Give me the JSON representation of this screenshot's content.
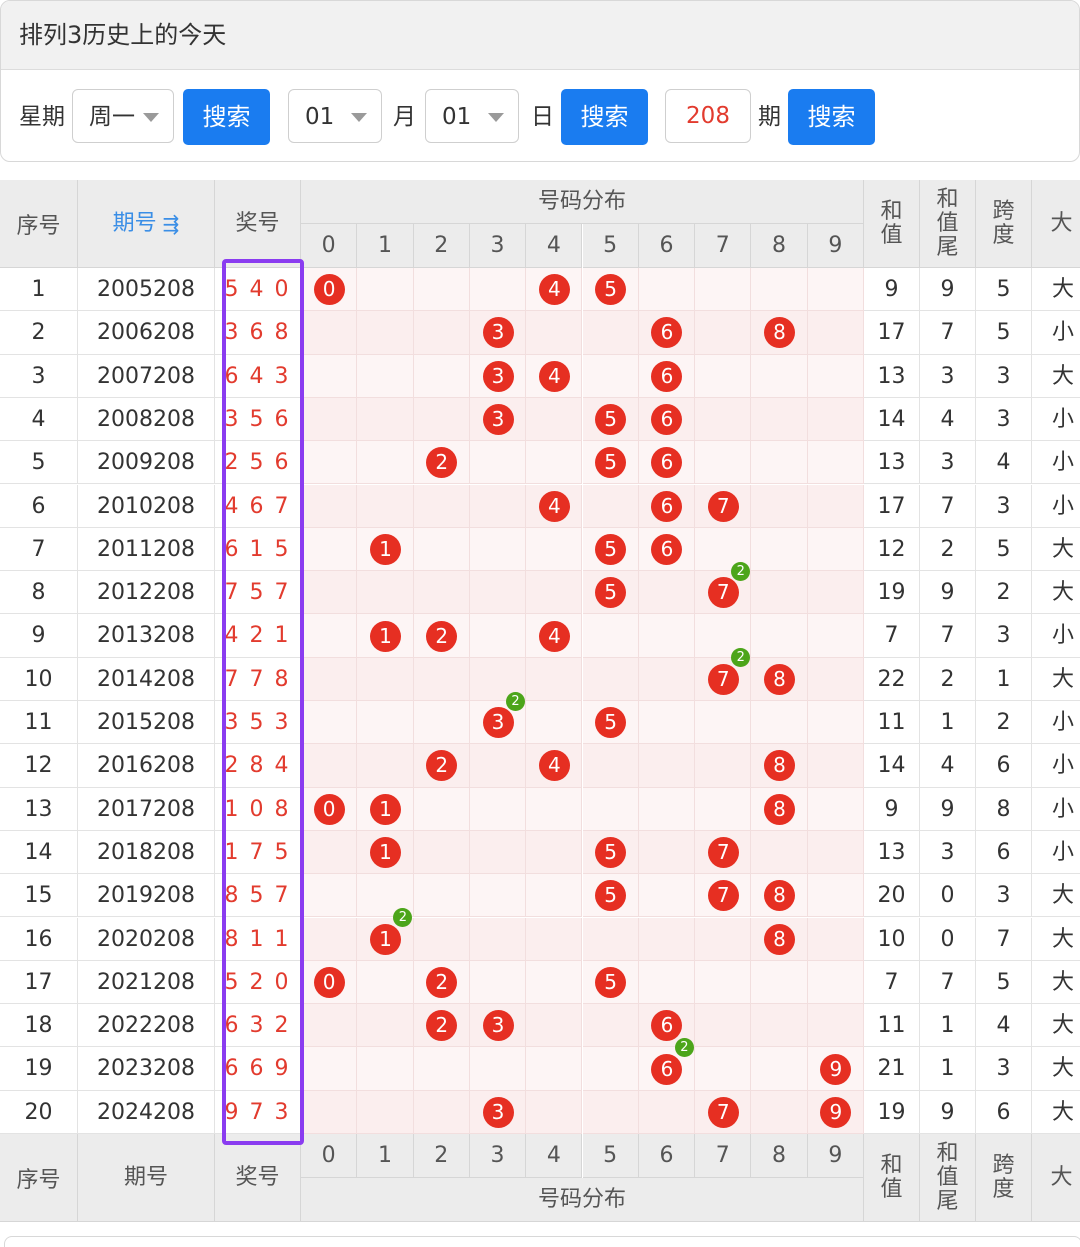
{
  "panel": {
    "title": "排列3历史上的今天",
    "weekday_label": "星期",
    "weekday_value": "周一",
    "search1": "搜索",
    "month_value": "01",
    "month_label": "月",
    "day_value": "01",
    "day_label": "日",
    "search2": "搜索",
    "issue_value": "208",
    "issue_label": "期",
    "search3": "搜索"
  },
  "table": {
    "col_index": "序号",
    "col_period": "期号",
    "col_period_sort_icon": "sort-desc-icon",
    "col_prize": "奖号",
    "col_dist": "号码分布",
    "digits": [
      "0",
      "1",
      "2",
      "3",
      "4",
      "5",
      "6",
      "7",
      "8",
      "9"
    ],
    "col_sum": [
      "和",
      "值"
    ],
    "col_sum_tail": [
      "和",
      "值",
      "尾"
    ],
    "col_span": [
      "跨",
      "度"
    ],
    "col_size_partial": "大",
    "rows": [
      {
        "idx": "1",
        "period": "2005208",
        "prize": "540",
        "sum": "9",
        "tail": "9",
        "span": "5",
        "size": "大"
      },
      {
        "idx": "2",
        "period": "2006208",
        "prize": "368",
        "sum": "17",
        "tail": "7",
        "span": "5",
        "size": "小"
      },
      {
        "idx": "3",
        "period": "2007208",
        "prize": "643",
        "sum": "13",
        "tail": "3",
        "span": "3",
        "size": "大"
      },
      {
        "idx": "4",
        "period": "2008208",
        "prize": "356",
        "sum": "14",
        "tail": "4",
        "span": "3",
        "size": "小"
      },
      {
        "idx": "5",
        "period": "2009208",
        "prize": "256",
        "sum": "13",
        "tail": "3",
        "span": "4",
        "size": "小"
      },
      {
        "idx": "6",
        "period": "2010208",
        "prize": "467",
        "sum": "17",
        "tail": "7",
        "span": "3",
        "size": "小"
      },
      {
        "idx": "7",
        "period": "2011208",
        "prize": "615",
        "sum": "12",
        "tail": "2",
        "span": "5",
        "size": "大"
      },
      {
        "idx": "8",
        "period": "2012208",
        "prize": "757",
        "sum": "19",
        "tail": "9",
        "span": "2",
        "size": "大"
      },
      {
        "idx": "9",
        "period": "2013208",
        "prize": "421",
        "sum": "7",
        "tail": "7",
        "span": "3",
        "size": "小"
      },
      {
        "idx": "10",
        "period": "2014208",
        "prize": "778",
        "sum": "22",
        "tail": "2",
        "span": "1",
        "size": "大"
      },
      {
        "idx": "11",
        "period": "2015208",
        "prize": "353",
        "sum": "11",
        "tail": "1",
        "span": "2",
        "size": "小"
      },
      {
        "idx": "12",
        "period": "2016208",
        "prize": "284",
        "sum": "14",
        "tail": "4",
        "span": "6",
        "size": "小"
      },
      {
        "idx": "13",
        "period": "2017208",
        "prize": "108",
        "sum": "9",
        "tail": "9",
        "span": "8",
        "size": "小"
      },
      {
        "idx": "14",
        "period": "2018208",
        "prize": "175",
        "sum": "13",
        "tail": "3",
        "span": "6",
        "size": "小"
      },
      {
        "idx": "15",
        "period": "2019208",
        "prize": "857",
        "sum": "20",
        "tail": "0",
        "span": "3",
        "size": "大"
      },
      {
        "idx": "16",
        "period": "2020208",
        "prize": "811",
        "sum": "10",
        "tail": "0",
        "span": "7",
        "size": "大"
      },
      {
        "idx": "17",
        "period": "2021208",
        "prize": "520",
        "sum": "7",
        "tail": "7",
        "span": "5",
        "size": "大"
      },
      {
        "idx": "18",
        "period": "2022208",
        "prize": "632",
        "sum": "11",
        "tail": "1",
        "span": "4",
        "size": "大"
      },
      {
        "idx": "19",
        "period": "2023208",
        "prize": "669",
        "sum": "21",
        "tail": "1",
        "span": "3",
        "size": "大"
      },
      {
        "idx": "20",
        "period": "2024208",
        "prize": "973",
        "sum": "19",
        "tail": "9",
        "span": "6",
        "size": "大"
      }
    ]
  },
  "colors": {
    "ball": "#e62f22",
    "badge": "#4ca51a",
    "button": "#1a7cf0",
    "highlight": "#8a3cf0",
    "prize_text": "#e23b2e"
  }
}
